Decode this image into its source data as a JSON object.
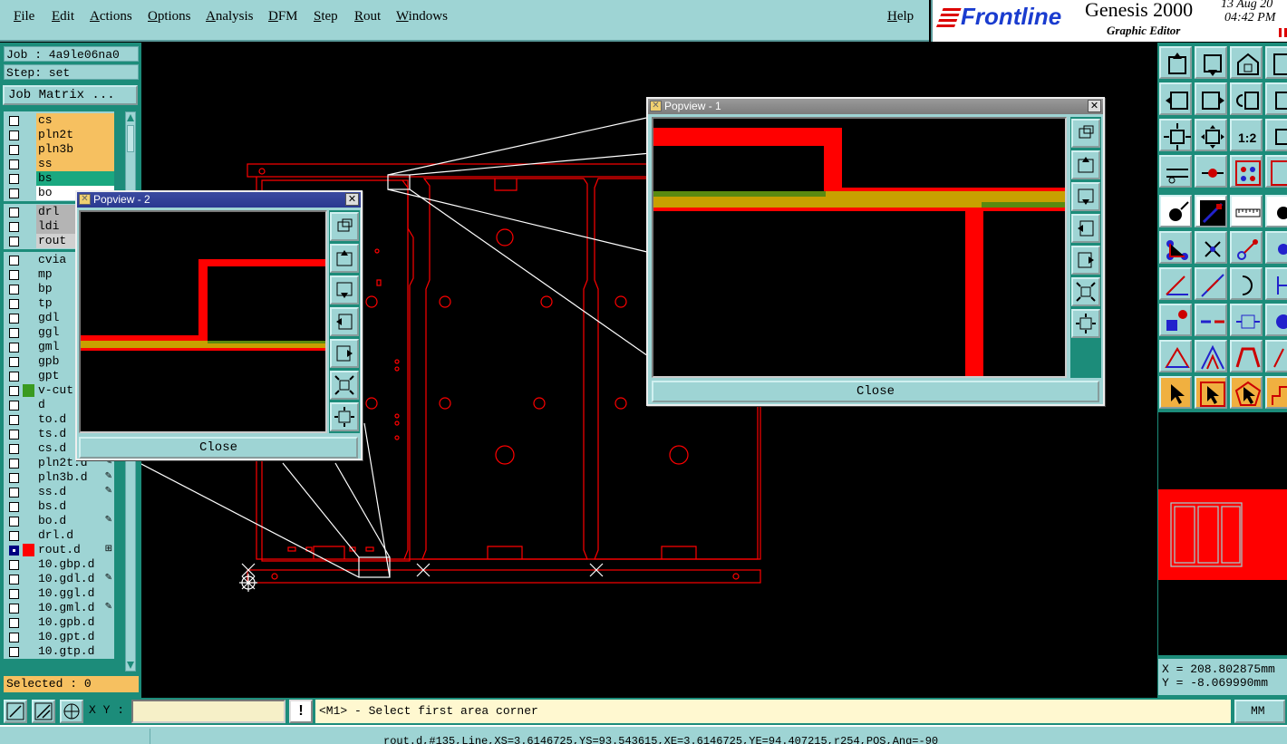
{
  "menu": {
    "items": [
      "File",
      "Edit",
      "Actions",
      "Options",
      "Analysis",
      "DFM",
      "Step",
      "Rout",
      "Windows"
    ],
    "help": "Help"
  },
  "brand": {
    "logo": "Frontline",
    "product": "Genesis 2000",
    "subtitle": "Graphic Editor",
    "date": "13 Aug 20",
    "time": "04:42 PM"
  },
  "left": {
    "job": "Job : 4a9le06na0",
    "step": "Step: set",
    "job_matrix": "Job Matrix ...",
    "selected": "Selected : 0",
    "layers": [
      {
        "name": "cs",
        "bg": "#f6c060",
        "color": "",
        "mark": ""
      },
      {
        "name": "pln2t",
        "bg": "#f6c060",
        "color": "",
        "mark": ""
      },
      {
        "name": "pln3b",
        "bg": "#f6c060",
        "color": "",
        "mark": ""
      },
      {
        "name": "ss",
        "bg": "#f6c060",
        "color": "",
        "mark": ""
      },
      {
        "name": "bs",
        "bg": "#1aa880",
        "color": "",
        "mark": ""
      },
      {
        "name": "bo",
        "bg": "#ffffff",
        "color": "",
        "mark": ""
      },
      {
        "name": "drl",
        "bg": "#b4b4b4",
        "color": "",
        "mark": ""
      },
      {
        "name": "ldi",
        "bg": "#b4b4b4",
        "color": "",
        "mark": ""
      },
      {
        "name": "rout",
        "bg": "#d0d0d0",
        "color": "",
        "mark": ""
      },
      {
        "name": "cvia",
        "bg": "#9ed4d4",
        "color": "",
        "mark": ""
      },
      {
        "name": "mp",
        "bg": "#9ed4d4",
        "color": "",
        "mark": ""
      },
      {
        "name": "bp",
        "bg": "#9ed4d4",
        "color": "",
        "mark": ""
      },
      {
        "name": "tp",
        "bg": "#9ed4d4",
        "color": "",
        "mark": ""
      },
      {
        "name": "gdl",
        "bg": "#9ed4d4",
        "color": "",
        "mark": ""
      },
      {
        "name": "ggl",
        "bg": "#9ed4d4",
        "color": "",
        "mark": ""
      },
      {
        "name": "gml",
        "bg": "#9ed4d4",
        "color": "",
        "mark": ""
      },
      {
        "name": "gpb",
        "bg": "#9ed4d4",
        "color": "",
        "mark": ""
      },
      {
        "name": "gpt",
        "bg": "#9ed4d4",
        "color": "",
        "mark": ""
      },
      {
        "name": "v-cut",
        "bg": "#9ed4d4",
        "color": "#3a9a20",
        "mark": ""
      },
      {
        "name": "d",
        "bg": "#9ed4d4",
        "color": "",
        "mark": ""
      },
      {
        "name": "to.d",
        "bg": "#9ed4d4",
        "color": "",
        "mark": ""
      },
      {
        "name": "ts.d",
        "bg": "#9ed4d4",
        "color": "",
        "mark": ""
      },
      {
        "name": "cs.d",
        "bg": "#9ed4d4",
        "color": "",
        "mark": ""
      },
      {
        "name": "pln2t.d",
        "bg": "#9ed4d4",
        "color": "",
        "mark": "✎"
      },
      {
        "name": "pln3b.d",
        "bg": "#9ed4d4",
        "color": "",
        "mark": "✎"
      },
      {
        "name": "ss.d",
        "bg": "#9ed4d4",
        "color": "",
        "mark": "✎"
      },
      {
        "name": "bs.d",
        "bg": "#9ed4d4",
        "color": "",
        "mark": ""
      },
      {
        "name": "bo.d",
        "bg": "#9ed4d4",
        "color": "",
        "mark": "✎"
      },
      {
        "name": "drl.d",
        "bg": "#9ed4d4",
        "color": "",
        "mark": ""
      },
      {
        "name": "rout.d",
        "bg": "#9ed4d4",
        "color": "#ff0000",
        "mark": "⊞"
      },
      {
        "name": "10.gbp.d",
        "bg": "#9ed4d4",
        "color": "",
        "mark": ""
      },
      {
        "name": "10.gdl.d",
        "bg": "#9ed4d4",
        "color": "",
        "mark": "✎"
      },
      {
        "name": "10.ggl.d",
        "bg": "#9ed4d4",
        "color": "",
        "mark": ""
      },
      {
        "name": "10.gml.d",
        "bg": "#9ed4d4",
        "color": "",
        "mark": "✎"
      },
      {
        "name": "10.gpb.d",
        "bg": "#9ed4d4",
        "color": "",
        "mark": ""
      },
      {
        "name": "10.gpt.d",
        "bg": "#9ed4d4",
        "color": "",
        "mark": ""
      },
      {
        "name": "10.gtp.d",
        "bg": "#9ed4d4",
        "color": "",
        "mark": ""
      }
    ]
  },
  "popview1": {
    "title": "Popview - 1",
    "close": "Close"
  },
  "popview2": {
    "title": "Popview - 2",
    "close": "Close"
  },
  "coords": {
    "x": "X = 208.802875mm",
    "y": "Y = -8.069990mm"
  },
  "bottom": {
    "xy_label": "X Y :",
    "xy_value": "",
    "alert": "!",
    "prompt": "<M1> - Select first area corner",
    "units": "MM"
  },
  "status": "rout.d,#135,Line,XS=3.6146725,YS=93.543615,XE=3.6146725,YE=94.407215,r254,POS,Ang=-90",
  "colors": {
    "panel": "#9ed4d4",
    "panel_dark": "#1c8c7a",
    "feature": "#ff0000",
    "highlight": "#f6c060"
  }
}
